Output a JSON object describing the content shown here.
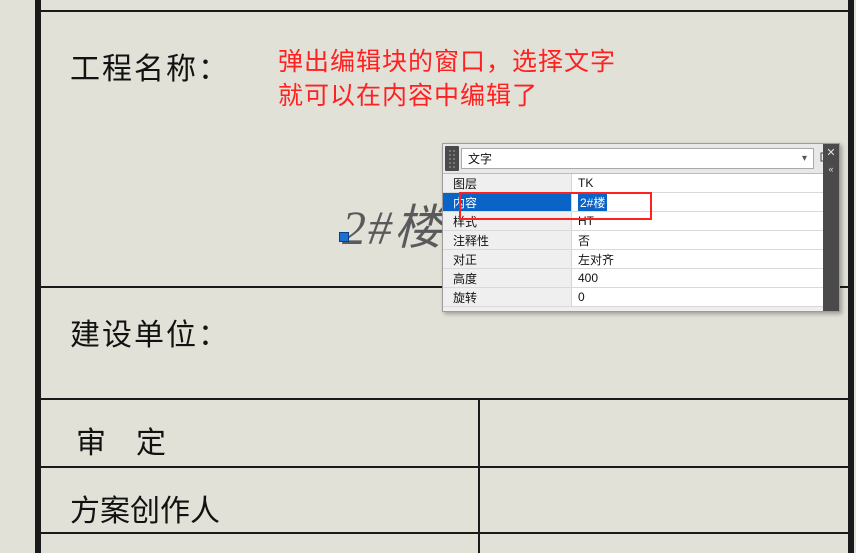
{
  "table": {
    "project_label": "工程名称：",
    "unit_label": "建设单位：",
    "review_label": "审    定",
    "author_label": "方案创作人"
  },
  "annotation": {
    "line1": "弹出编辑块的窗口，选择文字",
    "line2": "就可以在内容中编辑了"
  },
  "selected_text": "2#楼",
  "panel": {
    "title": "文字",
    "rows": [
      {
        "key": "图层",
        "value": "TK"
      },
      {
        "key": "内容",
        "value": "2#楼",
        "selected": true
      },
      {
        "key": "样式",
        "value": "HT"
      },
      {
        "key": "注释性",
        "value": "否"
      },
      {
        "key": "对正",
        "value": "左对齐"
      },
      {
        "key": "高度",
        "value": "400"
      },
      {
        "key": "旋转",
        "value": "0"
      }
    ]
  }
}
